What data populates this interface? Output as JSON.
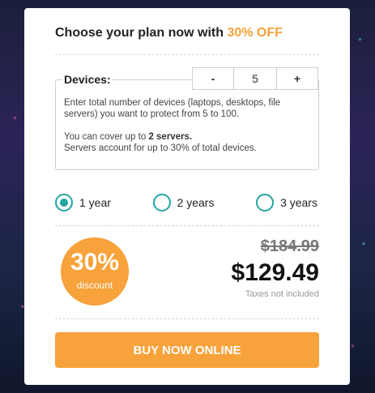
{
  "header": {
    "title_prefix": "Choose your plan now with ",
    "title_highlight": "30% OFF"
  },
  "devices": {
    "label": "Devices:",
    "decrement_label": "-",
    "value": "5",
    "increment_label": "+",
    "description_line1": "Enter total number of devices (laptops, desktops, file servers) you want to protect from 5 to 100.",
    "servers_prefix": "You can cover up to ",
    "servers_bold": "2 servers.",
    "servers_note": "Servers account for up to 30% of total devices."
  },
  "periods": [
    {
      "label": "1 year",
      "selected": true
    },
    {
      "label": "2 years",
      "selected": false
    },
    {
      "label": "3 years",
      "selected": false
    }
  ],
  "discount": {
    "percent": "30%",
    "label": "discount"
  },
  "pricing": {
    "old_price": "$184.99",
    "new_price": "$129.49",
    "tax_note": "Taxes not included"
  },
  "cta": {
    "label": "BUY NOW ONLINE"
  },
  "colors": {
    "accent_orange": "#f7a23a",
    "radio_teal": "#21a7a5"
  }
}
